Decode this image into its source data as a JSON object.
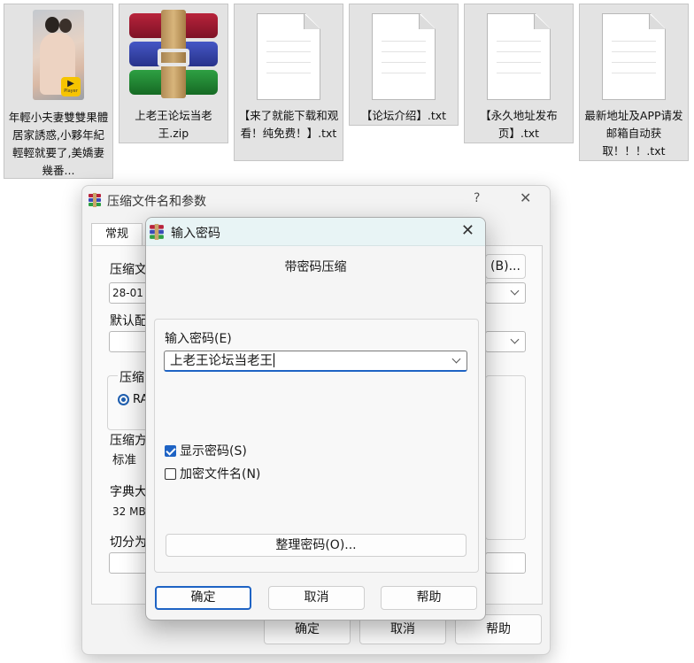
{
  "files": [
    {
      "name": "年輕小夫妻雙雙果體居家誘惑,小夥年紀輕輕就要了,美嬌妻幾番...",
      "icon": "video-thumbnail",
      "badge": "Player"
    },
    {
      "name": "上老王论坛当老王.zip",
      "icon": "winrar-archive-icon"
    },
    {
      "name": "【来了就能下载和观看！纯免费！】.txt",
      "icon": "text-file-icon"
    },
    {
      "name": "【论坛介绍】.txt",
      "icon": "text-file-icon"
    },
    {
      "name": "【永久地址发布页】.txt",
      "icon": "text-file-icon"
    },
    {
      "name": "最新地址及APP请发邮箱自动获取！！！.txt",
      "icon": "text-file-icon"
    }
  ],
  "archive_dialog": {
    "title": "压缩文件名和参数",
    "help_glyph": "?",
    "close_glyph": "✕",
    "tab_general": "常规",
    "label_archive_name": "压缩文",
    "archive_name_value": "28-01",
    "browse_label": "(B)...",
    "label_profile": "默认配",
    "label_format": "压缩",
    "format_option": "RA",
    "label_method": "压缩方",
    "method_value": "标准",
    "label_dict": "字典大",
    "dict_value": "32 MB",
    "label_split": "切分为",
    "ok_label": "确定",
    "cancel_label": "取消",
    "help_label": "帮助"
  },
  "password_dialog": {
    "title": "输入密码",
    "close_glyph": "✕",
    "heading": "带密码压缩",
    "password_label": "输入密码(E)",
    "password_value": "上老王论坛当老王",
    "show_password_label": "显示密码(S)",
    "show_password_checked": true,
    "encrypt_names_label": "加密文件名(N)",
    "encrypt_names_checked": false,
    "organize_label": "整理密码(O)...",
    "ok_label": "确定",
    "cancel_label": "取消",
    "help_label": "帮助"
  },
  "colors": {
    "accent": "#1e63c4",
    "titlebar": "#e8f4f5"
  }
}
